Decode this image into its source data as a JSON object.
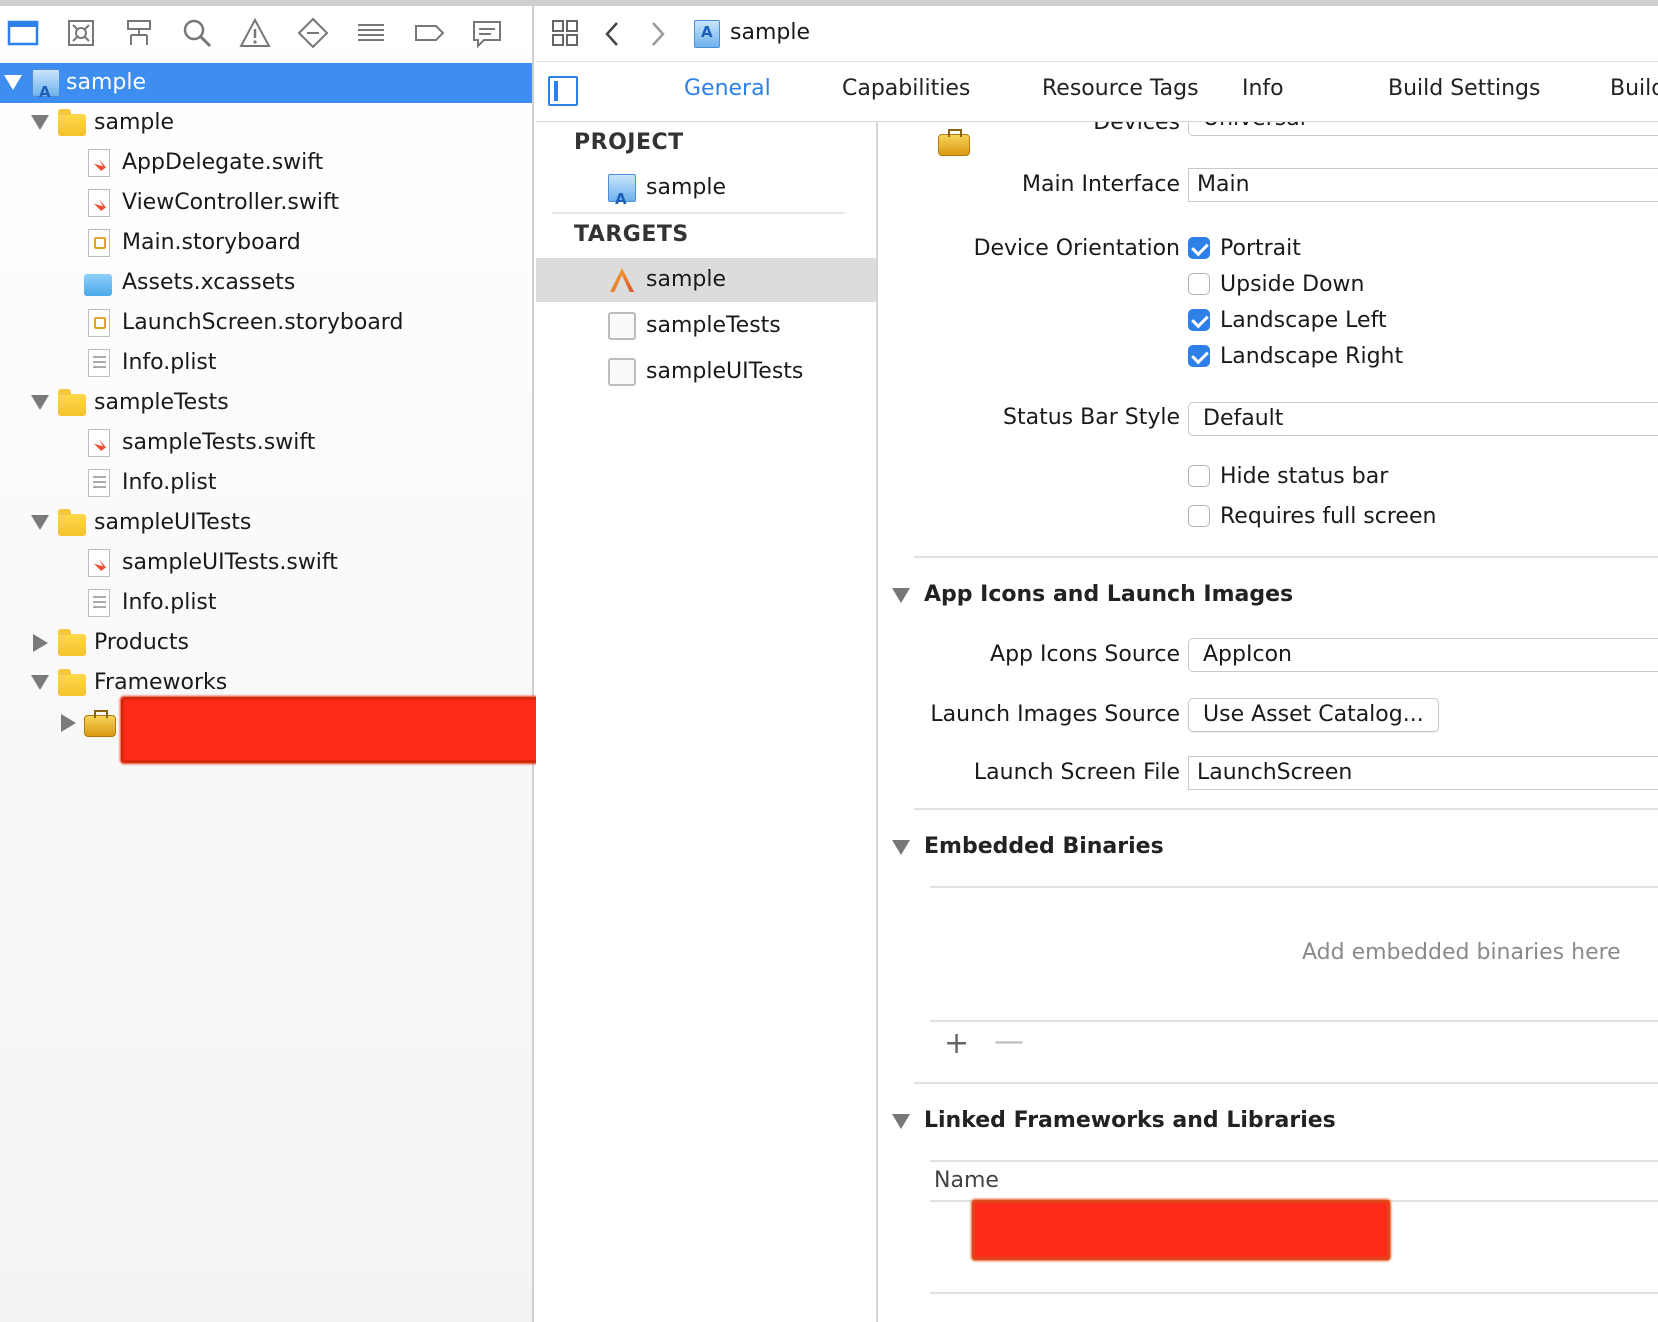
{
  "navigator": {
    "toolbar_icons": [
      "project-navigator-icon",
      "source-control-icon",
      "symbol-navigator-icon",
      "find-icon",
      "issue-icon",
      "test-icon",
      "debug-icon",
      "breakpoint-icon",
      "report-icon"
    ],
    "items": [
      {
        "label": "sample",
        "type": "project",
        "depth": 0,
        "expanded": true,
        "selected": true
      },
      {
        "label": "sample",
        "type": "folder",
        "depth": 1,
        "expanded": true
      },
      {
        "label": "AppDelegate.swift",
        "type": "swift",
        "depth": 2
      },
      {
        "label": "ViewController.swift",
        "type": "swift",
        "depth": 2
      },
      {
        "label": "Main.storyboard",
        "type": "storyboard",
        "depth": 2
      },
      {
        "label": "Assets.xcassets",
        "type": "assets",
        "depth": 2
      },
      {
        "label": "LaunchScreen.storyboard",
        "type": "storyboard",
        "depth": 2
      },
      {
        "label": "Info.plist",
        "type": "plist",
        "depth": 2
      },
      {
        "label": "sampleTests",
        "type": "folder",
        "depth": 1,
        "expanded": true
      },
      {
        "label": "sampleTests.swift",
        "type": "swift",
        "depth": 2
      },
      {
        "label": "Info.plist",
        "type": "plist",
        "depth": 2
      },
      {
        "label": "sampleUITests",
        "type": "folder",
        "depth": 1,
        "expanded": true
      },
      {
        "label": "sampleUITests.swift",
        "type": "swift",
        "depth": 2
      },
      {
        "label": "Info.plist",
        "type": "plist",
        "depth": 2
      },
      {
        "label": "Products",
        "type": "folder",
        "depth": 1,
        "expanded": false
      },
      {
        "label": "Frameworks",
        "type": "folder",
        "depth": 1,
        "expanded": true
      }
    ]
  },
  "editor": {
    "breadcrumb": "sample",
    "tabs": [
      "General",
      "Capabilities",
      "Resource Tags",
      "Info",
      "Build Settings",
      "Build"
    ],
    "active_tab": "General"
  },
  "targets_pane": {
    "project_header": "PROJECT",
    "project_item": "sample",
    "targets_header": "TARGETS",
    "targets": [
      "sample",
      "sampleTests",
      "sampleUITests"
    ]
  },
  "settings": {
    "devices_label": "Devices",
    "devices_value": "Universal",
    "main_interface_label": "Main Interface",
    "main_interface_value": "Main",
    "orientation_label": "Device Orientation",
    "orientations": [
      {
        "label": "Portrait",
        "checked": true
      },
      {
        "label": "Upside Down",
        "checked": false
      },
      {
        "label": "Landscape Left",
        "checked": true
      },
      {
        "label": "Landscape Right",
        "checked": true
      }
    ],
    "status_bar_label": "Status Bar Style",
    "status_bar_value": "Default",
    "hide_status_bar": "Hide status bar",
    "requires_full_screen": "Requires full screen",
    "app_icons_section": "App Icons and Launch Images",
    "app_icons_source_label": "App Icons Source",
    "app_icons_source_value": "AppIcon",
    "launch_images_label": "Launch Images Source",
    "launch_images_button": "Use Asset Catalog...",
    "launch_screen_label": "Launch Screen File",
    "launch_screen_value": "LaunchScreen",
    "embedded_section": "Embedded Binaries",
    "embedded_placeholder": "Add embedded binaries here",
    "add_symbol": "+",
    "remove_symbol": "—",
    "linked_section": "Linked Frameworks and Libraries",
    "name_column": "Name"
  },
  "colors": {
    "accent": "#2f7fe8",
    "selection": "#3d8ef0",
    "redaction": "#ff2a1a"
  }
}
